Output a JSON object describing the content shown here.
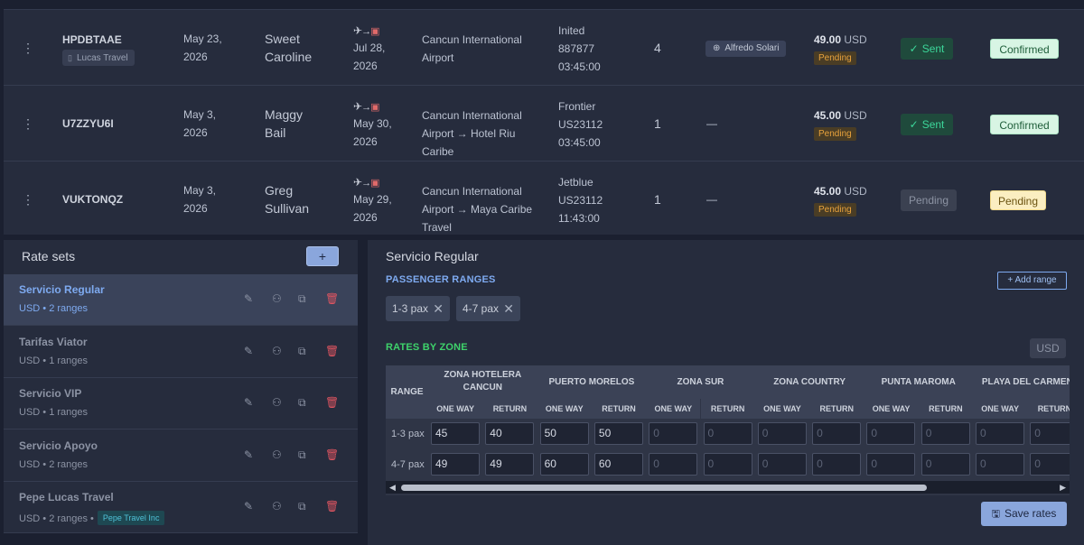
{
  "bookings": [
    {
      "code": "HPDBTAAE",
      "agency": "Lucas Travel",
      "date_line1": "May 23,",
      "date_line2": "2026",
      "passenger_line1": "Sweet",
      "passenger_line2": "Caroline",
      "trip_date_line1": "Jul 28,",
      "trip_date_line2": "2026",
      "route_lines": [
        "Cancun International",
        "Airport"
      ],
      "flight_lines": [
        "Inited",
        "887877",
        "03:45:00"
      ],
      "pax": "4",
      "driver": "Alfredo Solari",
      "price_amount": "49.00",
      "price_currency": "USD",
      "payment_status": "Pending",
      "notification_status": "Sent",
      "booking_status": "Confirmed"
    },
    {
      "code": "U7ZZYU6I",
      "agency": "",
      "date_line1": "May 3,",
      "date_line2": "2026",
      "passenger_line1": "Maggy",
      "passenger_line2": "Bail",
      "trip_date_line1": "May 30,",
      "trip_date_line2": "2026",
      "route_lines": [
        "Cancun International",
        "Airport → Hotel Riu",
        "Caribe"
      ],
      "flight_lines": [
        "Frontier",
        "US23112",
        "03:45:00"
      ],
      "pax": "1",
      "driver": "—",
      "price_amount": "45.00",
      "price_currency": "USD",
      "payment_status": "Pending",
      "notification_status": "Sent",
      "booking_status": "Confirmed"
    },
    {
      "code": "VUKTONQZ",
      "agency": "",
      "date_line1": "May 3,",
      "date_line2": "2026",
      "passenger_line1": "Greg",
      "passenger_line2": "Sullivan",
      "trip_date_line1": "May 29,",
      "trip_date_line2": "2026",
      "route_lines": [
        "Cancun International",
        "Airport → Maya Caribe",
        "Travel"
      ],
      "flight_lines": [
        "Jetblue",
        "US23112",
        "11:43:00"
      ],
      "pax": "1",
      "driver": "—",
      "price_amount": "45.00",
      "price_currency": "USD",
      "payment_status": "Pending",
      "notification_status": "Pending",
      "booking_status": "Pending"
    }
  ],
  "rate_sets": {
    "title": "Rate sets",
    "add_label": "+",
    "items": [
      {
        "name": "Servicio Regular",
        "meta": "USD • 2 ranges",
        "org": ""
      },
      {
        "name": "Tarifas Viator",
        "meta": "USD • 1 ranges",
        "org": ""
      },
      {
        "name": "Servicio VIP",
        "meta": "USD • 1 ranges",
        "org": ""
      },
      {
        "name": "Servicio Apoyo",
        "meta": "USD • 2 ranges",
        "org": ""
      },
      {
        "name": "Pepe Lucas Travel",
        "meta": "USD • 2 ranges •",
        "org": "Pepe Travel Inc"
      }
    ]
  },
  "editor": {
    "title": "Servicio Regular",
    "passenger_ranges_label": "PASSENGER RANGES",
    "add_range_label": "+ Add range",
    "ranges": [
      "1-3 pax",
      "4-7 pax"
    ],
    "rates_by_zone_label": "RATES BY ZONE",
    "currency": "USD",
    "range_header": "RANGE",
    "one_way_label": "ONE WAY",
    "return_label": "RETURN",
    "zones": [
      {
        "line1": "ZONA HOTELERA",
        "line2": "CANCUN"
      },
      {
        "line1": "PUERTO MORELOS",
        "line2": ""
      },
      {
        "line1": "ZONA SUR",
        "line2": ""
      },
      {
        "line1": "ZONA COUNTRY",
        "line2": ""
      },
      {
        "line1": "PUNTA MAROMA",
        "line2": ""
      },
      {
        "line1": "PLAYA DEL CARMEN",
        "line2": ""
      }
    ],
    "rows": [
      {
        "label": "1-3 pax",
        "values": [
          "45",
          "40",
          "50",
          "50",
          "0",
          "0",
          "0",
          "0",
          "0",
          "0",
          "0",
          "0"
        ]
      },
      {
        "label": "4-7 pax",
        "values": [
          "49",
          "49",
          "60",
          "60",
          "0",
          "0",
          "0",
          "0",
          "0",
          "0",
          "0",
          "0"
        ]
      }
    ],
    "save_label": "Save rates"
  }
}
